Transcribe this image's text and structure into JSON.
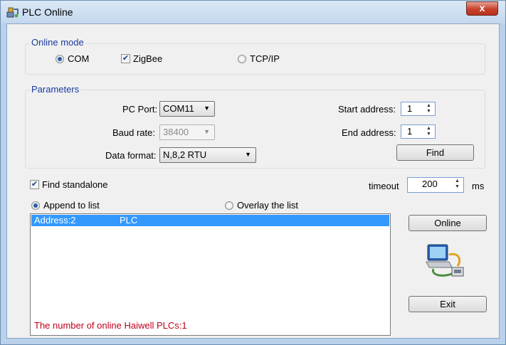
{
  "window": {
    "title": "PLC Online",
    "close_glyph": "x"
  },
  "online_mode": {
    "legend": "Online mode",
    "com_label": "COM",
    "zigbee_label": "ZigBee",
    "zigbee_checked": true,
    "tcpip_label": "TCP/IP",
    "selected": "COM"
  },
  "parameters": {
    "legend": "Parameters",
    "pc_port_label": "PC Port:",
    "pc_port_value": "COM11",
    "baud_rate_label": "Baud rate:",
    "baud_rate_value": "38400",
    "data_format_label": "Data format:",
    "data_format_value": "N,8,2 RTU",
    "start_address_label": "Start address:",
    "start_address_value": "1",
    "end_address_label": "End address:",
    "end_address_value": "1",
    "find_label": "Find"
  },
  "find_standalone": {
    "label": "Find standalone",
    "checked": true
  },
  "timeout": {
    "label": "timeout",
    "value": "200",
    "unit": "ms"
  },
  "list_mode": {
    "append_label": "Append to list",
    "overlay_label": "Overlay the list",
    "selected": "append"
  },
  "results": [
    {
      "address": "Address:2",
      "type": "PLC"
    }
  ],
  "buttons": {
    "online_label": "Online",
    "exit_label": "Exit"
  },
  "status": {
    "text": "The number of online Haiwell PLCs:1",
    "color": "#c0001a"
  },
  "icons": {
    "app": "plc-app-icon",
    "connection": "computer-connection-icon"
  }
}
